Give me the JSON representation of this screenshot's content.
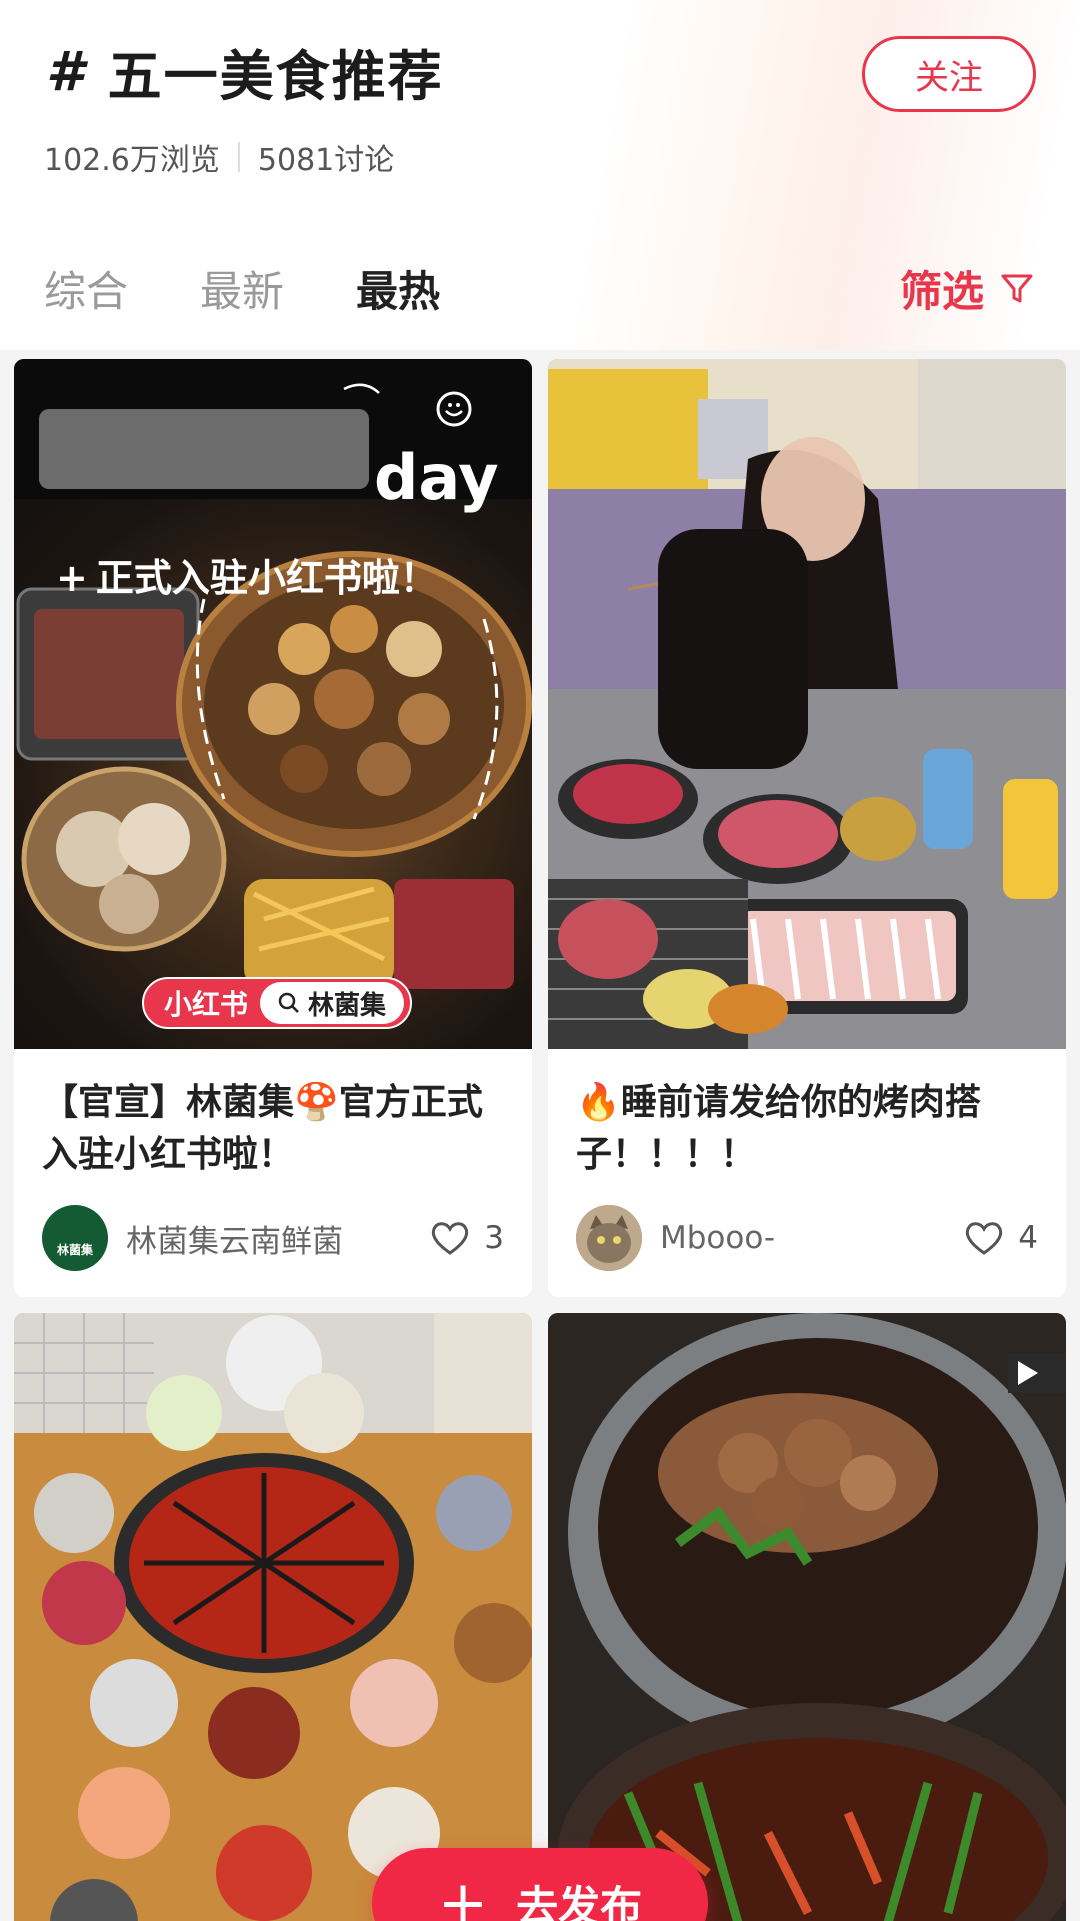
{
  "topic": {
    "hash_icon": "#",
    "title": "五一美食推荐",
    "follow_label": "关注",
    "views": "102.6万浏览",
    "discussions": "5081讨论"
  },
  "tabs": [
    {
      "label": "综合",
      "active": false
    },
    {
      "label": "最新",
      "active": false
    },
    {
      "label": "最热",
      "active": true
    }
  ],
  "filter": {
    "label": "筛选",
    "icon": "funnel-icon"
  },
  "posts": [
    {
      "cover_text_day": "day",
      "cover_slogan": "正式入驻小红书啦！",
      "cover_badge_brand": "小红书",
      "cover_badge_search": "林菌集",
      "title": "【官宣】林菌集🍄官方正式入驻小红书啦！",
      "author": "林菌集云南鲜菌",
      "avatar_text": "林菌集",
      "likes": "3"
    },
    {
      "title": "🔥睡前请发给你的烤肉搭子！！！！",
      "author": "Mbooo-",
      "likes": "4"
    },
    {
      "title": "",
      "author": "",
      "likes": ""
    },
    {
      "title": "",
      "author": "",
      "likes": ""
    }
  ],
  "publish": {
    "icon": "+",
    "label": "去发布"
  },
  "colors": {
    "accent": "#e8364c",
    "publish": "#f02745"
  }
}
